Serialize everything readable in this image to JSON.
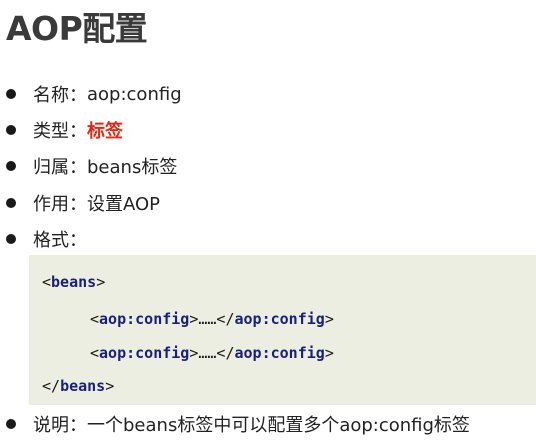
{
  "title": "AOP配置",
  "items": [
    {
      "label": "名称：",
      "value": "aop:config"
    },
    {
      "label": "类型：",
      "value": "标签"
    },
    {
      "label": "归属：",
      "value": "beans标签"
    },
    {
      "label": "作用：",
      "value": "设置AOP"
    },
    {
      "label": "格式：",
      "value": ""
    }
  ],
  "code": {
    "line1": {
      "open": "<",
      "name": "beans",
      "close": ">"
    },
    "line2": {
      "open": "<",
      "name": "aop:config",
      "mid": ">……</",
      "name2": "aop:config",
      "close": ">"
    },
    "line3": {
      "open": "<",
      "name": "aop:config",
      "mid": ">……</",
      "name2": "aop:config",
      "close": ">"
    },
    "line4": {
      "open": "</",
      "name": "beans",
      "close": ">"
    }
  },
  "note": {
    "label": "说明：",
    "value": "一个beans标签中可以配置多个aop:config标签"
  },
  "colors": {
    "highlight": "#e02a16",
    "keyword": "#1a1f7a",
    "code_bg": "#ebeee0"
  }
}
